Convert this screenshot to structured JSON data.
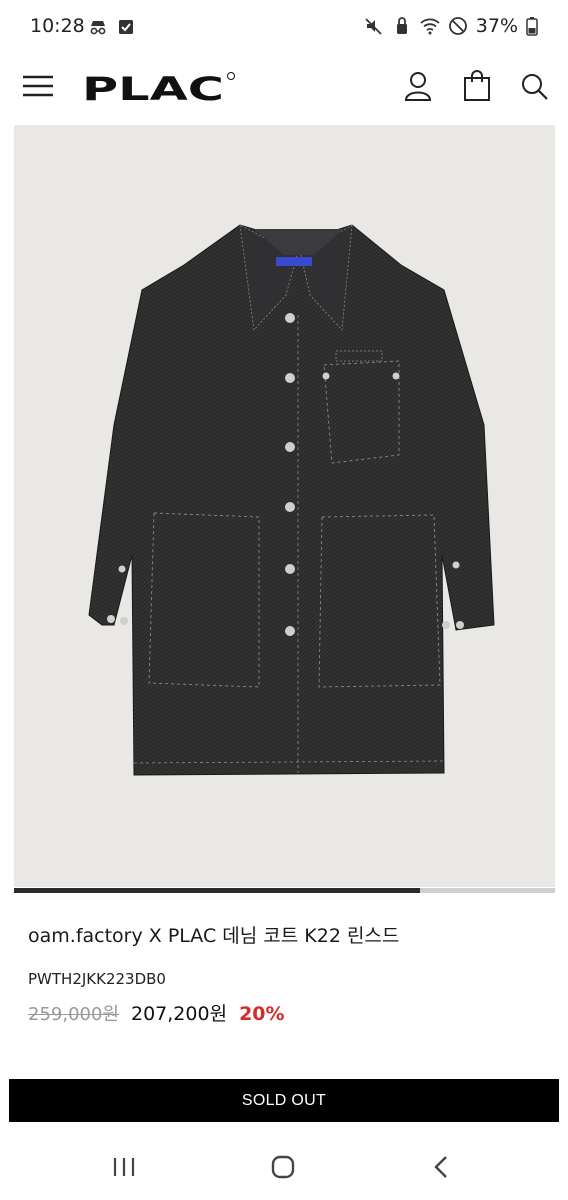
{
  "status_bar": {
    "time": "10:28",
    "battery": "37%",
    "left_icons": [
      "incognito-icon",
      "checkbox-icon"
    ],
    "right_icons": [
      "mute-icon",
      "vpn-lock-icon",
      "wifi-icon",
      "do-not-disturb-icon",
      "battery-icon"
    ]
  },
  "header": {
    "logo_text": "PLAC",
    "icons": [
      "menu-icon",
      "user-icon",
      "shopping-bag-icon",
      "search-icon"
    ]
  },
  "product": {
    "image_alt": "denim coat",
    "image_progress": 0.75,
    "title": "oam.factory X PLAC 데님 코트 K22 린스드",
    "code": "PWTH2JKK223DB0",
    "original_price": "259,000원",
    "sale_price": "207,200원",
    "discount": "20%"
  },
  "actions": {
    "sold_out_label": "SOLD OUT"
  },
  "system_nav": {
    "icons": [
      "recent-apps-icon",
      "home-icon",
      "back-icon"
    ]
  },
  "colors": {
    "accent_discount": "#d62b2b",
    "button_bg": "#000000",
    "image_bg": "#e9e8e5"
  }
}
